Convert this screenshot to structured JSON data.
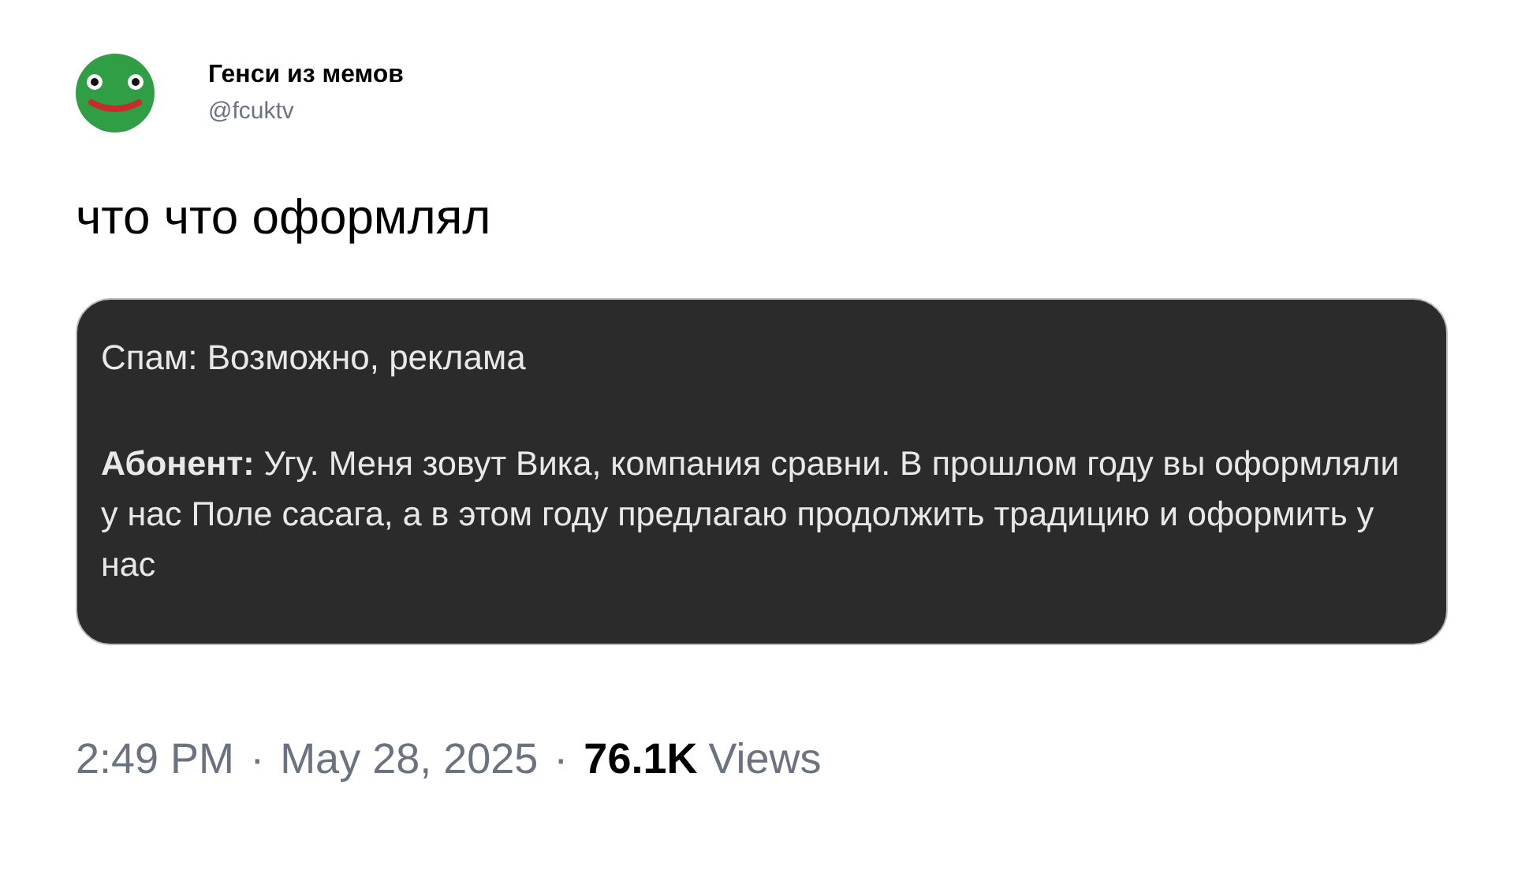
{
  "author": {
    "name": "Генси из мемов",
    "handle": "@fcuktv"
  },
  "tweet_text": "что что оформлял",
  "attached_screenshot": {
    "spam_label": "Спам: Возможно, реклама",
    "transcript": "**Абонент:** Угу. Меня зовут Вика, компания сравни. В прошлом году вы оформляли у нас Поле сасага, а в этом году предлагаю продолжить традицию и оформить у нас"
  },
  "meta": {
    "time": "2:49 PM",
    "separators": [
      "·",
      "·"
    ],
    "date": "May 28, 2025",
    "views_count": "76.1K",
    "views_label": "Views"
  }
}
